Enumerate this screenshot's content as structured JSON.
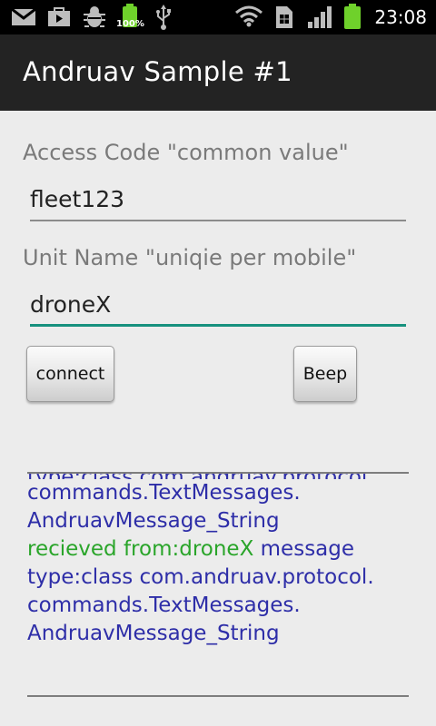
{
  "status_bar": {
    "time": "23:08",
    "battery_percent_label": "100%",
    "icons": [
      "gmail-icon",
      "play-store-icon",
      "android-debug-icon",
      "battery-full-icon",
      "usb-icon",
      "wifi-icon",
      "sim-card-icon",
      "signal-bars-icon",
      "battery-icon"
    ]
  },
  "app": {
    "title": "Andruav Sample #1"
  },
  "form": {
    "access_code_label": "Access Code \"common value\"",
    "access_code_value": "fleet123",
    "unit_name_label": "Unit Name \"uniqie per mobile\"",
    "unit_name_value": "droneX"
  },
  "buttons": {
    "connect_label": "connect",
    "beep_label": "Beep"
  },
  "log": {
    "line_partial": "type:class com.andruav.protocol.",
    "line_1": "commands.TextMessages.",
    "line_2": "AndruavMessage_String",
    "received_prefix": "recieved from:droneX",
    "received_suffix": " message",
    "line_4": "type:class com.andruav.protocol.",
    "line_5": "commands.TextMessages.",
    "line_6": "AndruavMessage_String"
  },
  "colors": {
    "accent_focus": "#17917e",
    "log_text": "#2e2ea8",
    "log_received": "#2aa52a",
    "title_bar": "#232323"
  }
}
